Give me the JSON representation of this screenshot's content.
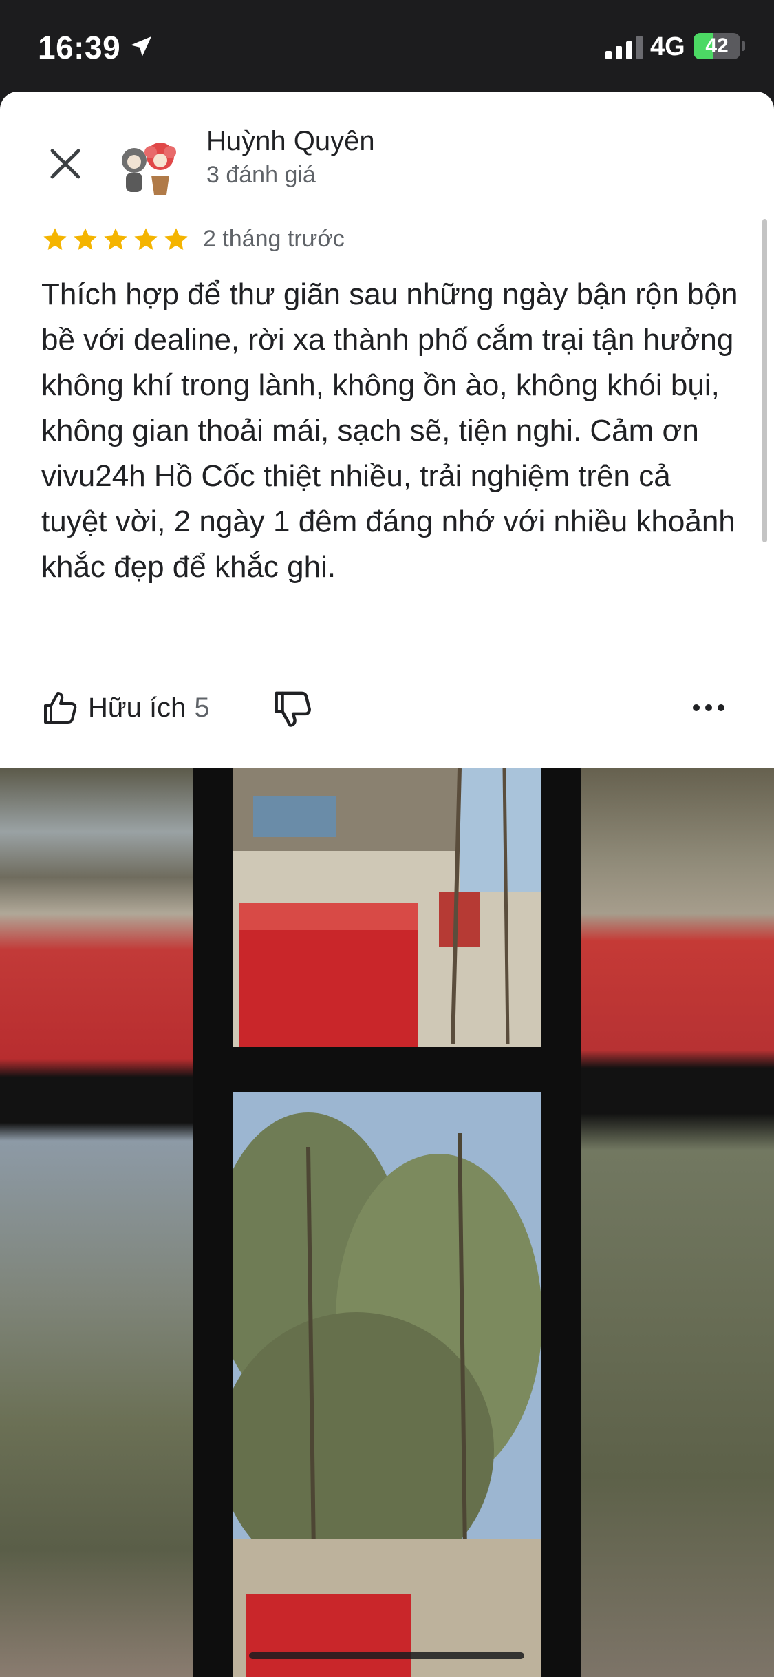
{
  "status_bar": {
    "time": "16:39",
    "network": "4G",
    "battery_percent": "42",
    "battery_level": 0.42,
    "icons": [
      "location-arrow-icon",
      "signal-bars-icon",
      "battery-charging-icon"
    ]
  },
  "review": {
    "reviewer_name": "Huỳnh Quyên",
    "review_count": "3 đánh giá",
    "rating": 5,
    "time_ago": "2 tháng trước",
    "text": "Thích hợp để thư giãn sau những ngày bận rộn bộn bề với dealine, rời xa thành phố cắm trại tận hưởng không khí trong lành, không ồn ào, không khói bụi, không gian thoải mái, sạch sẽ, tiện nghi. Cảm ơn vivu24h Hồ Cốc thiệt nhiều, trải nghiệm trên cả tuyệt vời, 2 ngày 1 đêm đáng nhớ với nhiều khoảnh khắc đẹp để khắc ghi."
  },
  "actions": {
    "helpful_label": "Hữu ích",
    "helpful_count": "5",
    "icons": [
      "thumb-up-icon",
      "thumb-down-icon",
      "more-options-icon",
      "close-icon"
    ]
  },
  "colors": {
    "star": "#f4b400",
    "text_primary": "#202124",
    "text_secondary": "#5f6368",
    "status_bar_bg": "#1c1c1e",
    "battery_fill": "#4cd964"
  }
}
